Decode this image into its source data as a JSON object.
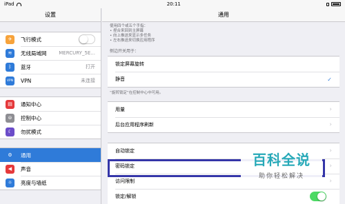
{
  "status_bar": {
    "carrier": "iPad",
    "time": "20:11",
    "battery": ""
  },
  "sidebar": {
    "title": "设置",
    "groups": [
      [
        {
          "label": "飞行模式",
          "icon": "airplane-icon",
          "color": "#f7a33b",
          "toggle": false
        },
        {
          "label": "无线局域网",
          "icon": "wifi-icon",
          "color": "#2f7bd9",
          "value": "MERCURY_5E..."
        },
        {
          "label": "蓝牙",
          "icon": "bluetooth-icon",
          "color": "#2f7bd9",
          "value": "打开"
        },
        {
          "label": "VPN",
          "icon": "vpn-icon",
          "color": "#2f7bd9",
          "value": "未连接"
        }
      ],
      [
        {
          "label": "通知中心",
          "icon": "notification-icon",
          "color": "#e5393b"
        },
        {
          "label": "控制中心",
          "icon": "control-center-icon",
          "color": "#8e8e93"
        },
        {
          "label": "勿扰模式",
          "icon": "moon-icon",
          "color": "#6b4cc9"
        }
      ],
      [
        {
          "label": "通用",
          "icon": "gear-icon",
          "color": "#8e8e93",
          "selected": true
        },
        {
          "label": "声音",
          "icon": "sound-icon",
          "color": "#e5393b"
        },
        {
          "label": "亮度与墙纸",
          "icon": "brightness-icon",
          "color": "#2f7bd9"
        }
      ]
    ]
  },
  "detail": {
    "title": "通用",
    "gesture_notes": [
      "使用四个或五个手指：",
      "• 捏合来回到主屏幕",
      "• 向上推送来显示多任务",
      "• 左右推送来切换应用程序"
    ],
    "side_switch_caption": "侧边开关用于：",
    "side_switch_options": [
      {
        "label": "锁定屏幕旋转",
        "checked": false
      },
      {
        "label": "静音",
        "checked": true
      }
    ],
    "side_switch_footer": "“旋转锁定”在控制中心中可用。",
    "usage_rows": [
      "用量",
      "后台应用程序刷新"
    ],
    "lock_rows": [
      {
        "label": "自动锁定",
        "chevron": true
      },
      {
        "label": "密码锁定",
        "chevron": true
      },
      {
        "label": "访问限制",
        "chevron": true
      },
      {
        "label": "锁定/解锁",
        "toggle": true
      }
    ]
  },
  "watermark": {
    "title": "百科全说",
    "subtitle": "助你轻松解决"
  }
}
